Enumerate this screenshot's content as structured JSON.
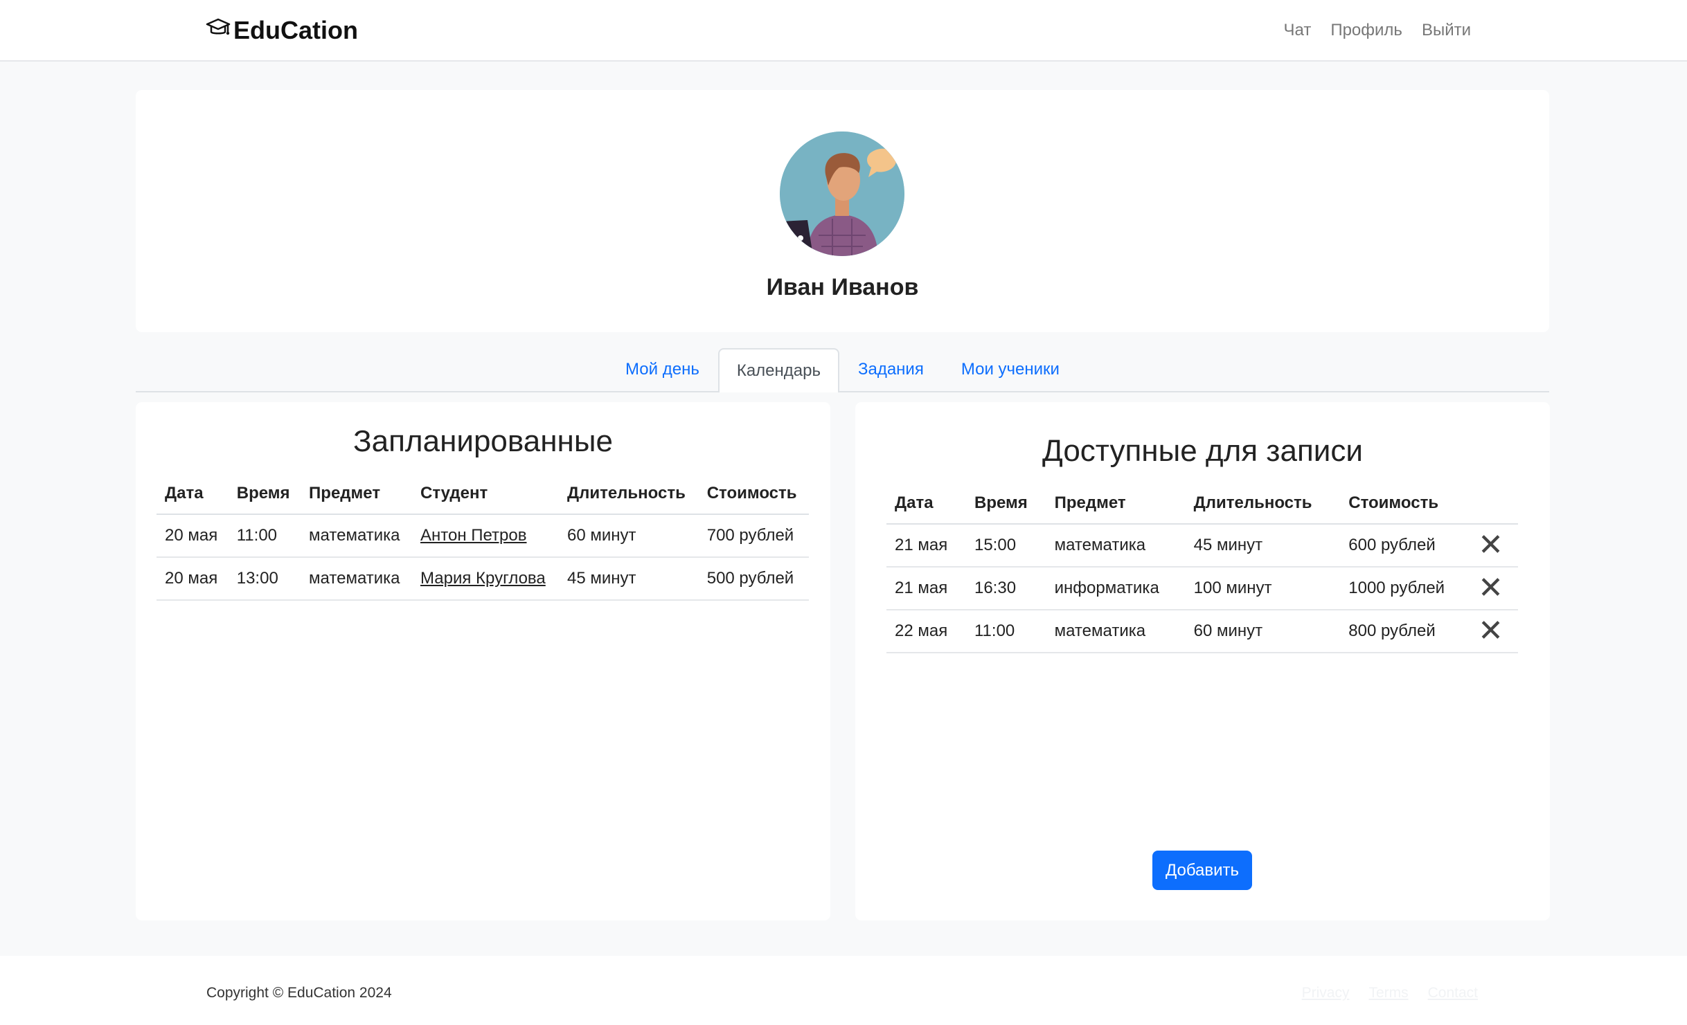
{
  "navbar": {
    "brand": "EduCation",
    "brand_icon": "graduation-cap-icon",
    "links": [
      "Чат",
      "Профиль",
      "Выйти"
    ]
  },
  "profile": {
    "name": "Иван Иванов"
  },
  "tabs": [
    {
      "label": "Мой день",
      "active": false
    },
    {
      "label": "Календарь",
      "active": true
    },
    {
      "label": "Задания",
      "active": false
    },
    {
      "label": "Мои ученики",
      "active": false
    }
  ],
  "scheduled": {
    "title": "Запланированные",
    "headers": [
      "Дата",
      "Время",
      "Предмет",
      "Студент",
      "Длительность",
      "Стоимость"
    ],
    "rows": [
      [
        "20 мая",
        "11:00",
        "математика",
        "Антон Петров",
        "60 минут",
        "700 рублей"
      ],
      [
        "20 мая",
        "13:00",
        "математика",
        "Мария Круглова",
        "45 минут",
        "500 рублей"
      ]
    ]
  },
  "available": {
    "title": "Доступные для записи",
    "headers": [
      "Дата",
      "Время",
      "Предмет",
      "Длительность",
      "Стоимость"
    ],
    "rows": [
      [
        "21 мая",
        "15:00",
        "математика",
        "45 минут",
        "600 рублей"
      ],
      [
        "21 мая",
        "16:30",
        "информатика",
        "100 минут",
        "1000 рублей"
      ],
      [
        "22 мая",
        "11:00",
        "математика",
        "60 минут",
        "800 рублей"
      ]
    ],
    "remove_icon": "close-icon",
    "add_label": "Добавить"
  },
  "footer": {
    "copyright": "Copyright © EduCation 2024",
    "links": [
      "Privacy",
      "Terms",
      "Contact"
    ]
  },
  "colors": {
    "accent": "#0d6efd",
    "background": "#f8f9fa"
  }
}
